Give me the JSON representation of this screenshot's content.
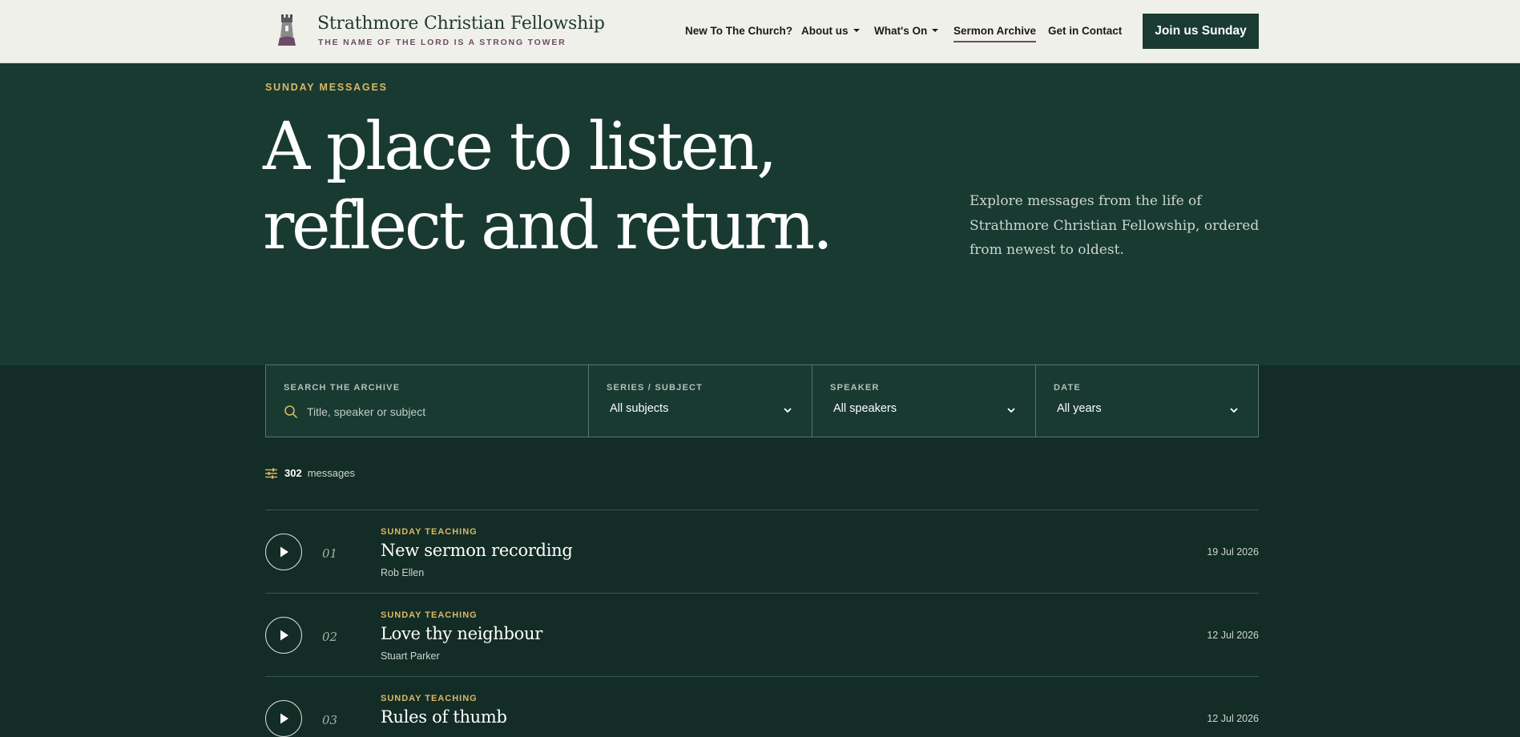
{
  "site": {
    "name": "Strathmore Christian Fellowship",
    "tagline": "THE NAME OF THE LORD IS A STRONG TOWER"
  },
  "nav": {
    "items": [
      {
        "label": "New To The Church?",
        "dropdown": false
      },
      {
        "label": "About us",
        "dropdown": true
      },
      {
        "label": "What's On",
        "dropdown": true
      },
      {
        "label": "Sermon Archive",
        "dropdown": false,
        "active": true
      },
      {
        "label": "Get in Contact",
        "dropdown": false
      }
    ],
    "cta_label": "Join us Sunday"
  },
  "hero": {
    "eyebrow": "SUNDAY MESSAGES",
    "headline_line1": "A place to listen,",
    "headline_line2": "reflect and return.",
    "intro": "Explore messages from the life of Strathmore Christian Fellowship, ordered from newest to oldest."
  },
  "filters": {
    "search": {
      "label": "SEARCH THE ARCHIVE",
      "placeholder": "Title, speaker or subject",
      "value": ""
    },
    "series": {
      "label": "SERIES / SUBJECT",
      "value": "All subjects"
    },
    "speaker": {
      "label": "SPEAKER",
      "value": "All speakers"
    },
    "date": {
      "label": "DATE",
      "value": "All years"
    }
  },
  "results": {
    "count": "302",
    "count_label": "messages"
  },
  "sermons": [
    {
      "index": "01",
      "category": "SUNDAY TEACHING",
      "title": "New sermon recording",
      "speaker": "Rob Ellen",
      "date": "19 Jul 2026"
    },
    {
      "index": "02",
      "category": "SUNDAY TEACHING",
      "title": "Love thy neighbour",
      "speaker": "Stuart Parker",
      "date": "12 Jul 2026"
    },
    {
      "index": "03",
      "category": "SUNDAY TEACHING",
      "title": "Rules of thumb",
      "speaker": "",
      "date": "12 Jul 2026"
    }
  ],
  "colors": {
    "header_bg": "#f0f0eb",
    "hero_bg": "#183a31",
    "page_bg": "#132c25",
    "accent_gold": "#d9b867",
    "accent_plum": "#6e4a66",
    "cta_bg": "#1a3b32"
  },
  "icons": {
    "logo": "tower-icon",
    "search": "search-icon",
    "filter": "sliders-icon",
    "play": "play-icon",
    "chevron": "chevron-down-icon"
  }
}
